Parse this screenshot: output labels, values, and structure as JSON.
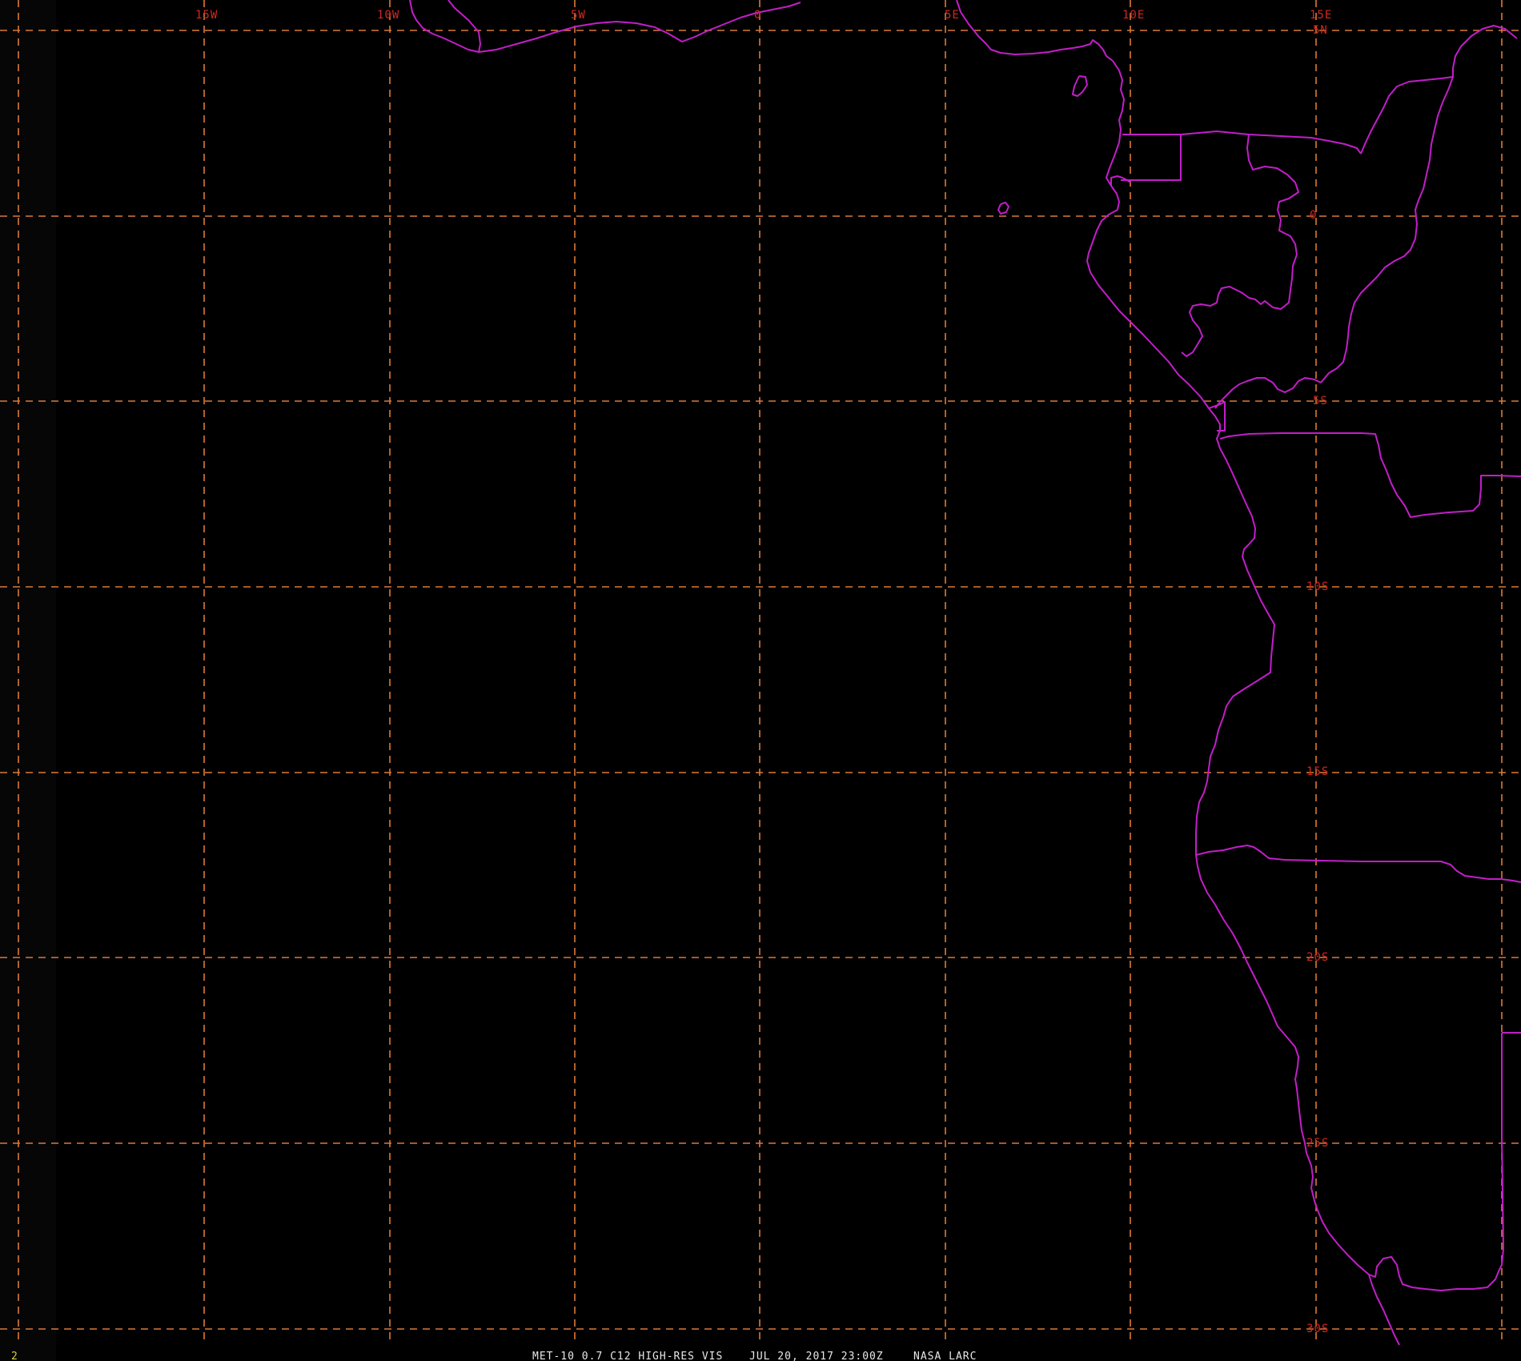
{
  "lon_labels": [
    "15W",
    "10W",
    "5W",
    "0",
    "5E",
    "10E",
    "15E"
  ],
  "lat_labels": [
    "5N",
    "0",
    "5S",
    "10S",
    "15S",
    "20S",
    "25S",
    "30S"
  ],
  "footer": {
    "product": "MET-10 0.7 C12 HIGH-RES VIS",
    "datetime": "JUL 20, 2017 23:00Z",
    "source": "NASA LARC"
  },
  "frame_number": "2",
  "colors": {
    "background": "#000000",
    "grid": "#d97a3a",
    "labels": "#d3271f",
    "coastline": "#c21ec9",
    "footer_text": "#e8e8e8",
    "frame_number": "#d8d23a"
  }
}
